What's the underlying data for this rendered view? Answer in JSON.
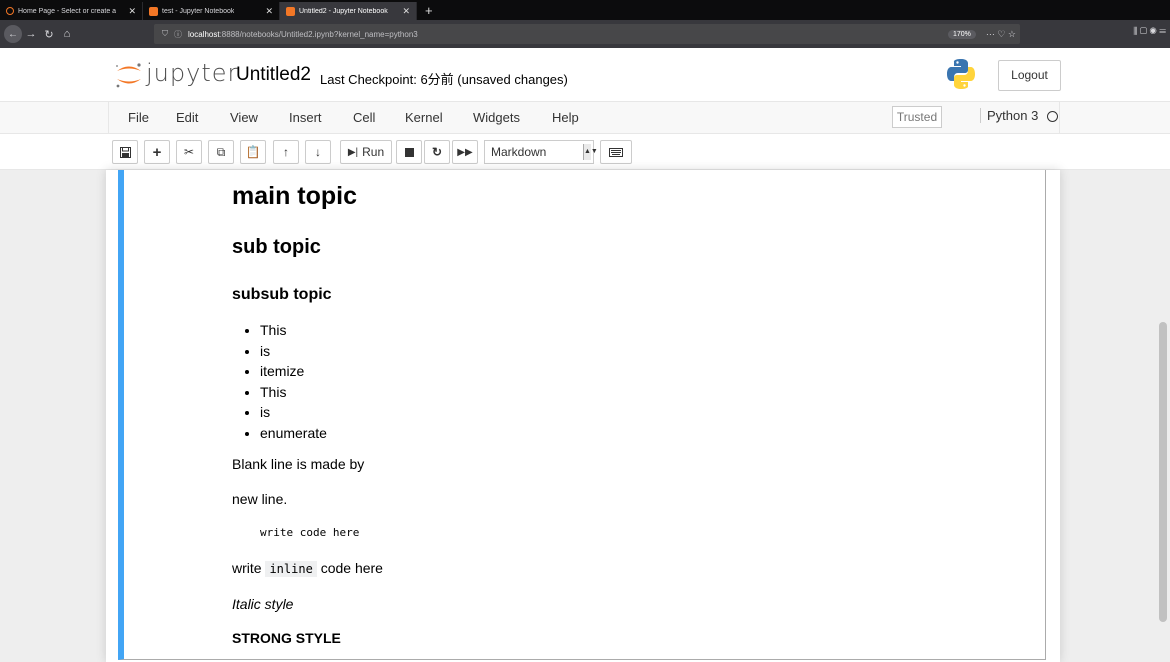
{
  "browser": {
    "tabs": [
      {
        "label": "Home Page - Select or create a",
        "active": false,
        "color": "#f37726"
      },
      {
        "label": "test - Jupyter Notebook",
        "active": false,
        "color": "#f37726"
      },
      {
        "label": "Untitled2 - Jupyter Notebook",
        "active": true,
        "color": "#f37726"
      }
    ],
    "tab_close": "✕",
    "new_tab": "+",
    "url_info": "ⓘ",
    "url_host": "localhost",
    "url_rest": ":8888/notebooks/Untitled2.ipynb?kernel_name=python3",
    "zoom": "170%",
    "url_actions": "··· ♡ ☆",
    "nav_right": "⫼  ▢  ◉  ☰"
  },
  "header": {
    "logo_text": "jupyter",
    "notebook_title": "Untitled2",
    "checkpoint": "Last Checkpoint: 6分前  (unsaved changes)",
    "logout": "Logout"
  },
  "menu": {
    "items": [
      "File",
      "Edit",
      "View",
      "Insert",
      "Cell",
      "Kernel",
      "Widgets",
      "Help"
    ],
    "trusted": "Trusted",
    "kernel": "Python 3"
  },
  "toolbar": {
    "run_label": "Run",
    "cell_type": "Markdown"
  },
  "cell": {
    "h1": "main topic",
    "h2": "sub topic",
    "h3": "subsub topic",
    "list": [
      "This",
      "is",
      "itemize",
      "This",
      "is",
      "enumerate"
    ],
    "para1": "Blank line is made by",
    "para2": "new line.",
    "code_block": "write code here",
    "inline_before": "write",
    "inline_code": "inline",
    "inline_after": "code here",
    "italic": "Italic style",
    "strong": "STRONG STYLE"
  },
  "colors": {
    "edit_accent": "#42a5f5",
    "jupyter_orange": "#f37726"
  }
}
